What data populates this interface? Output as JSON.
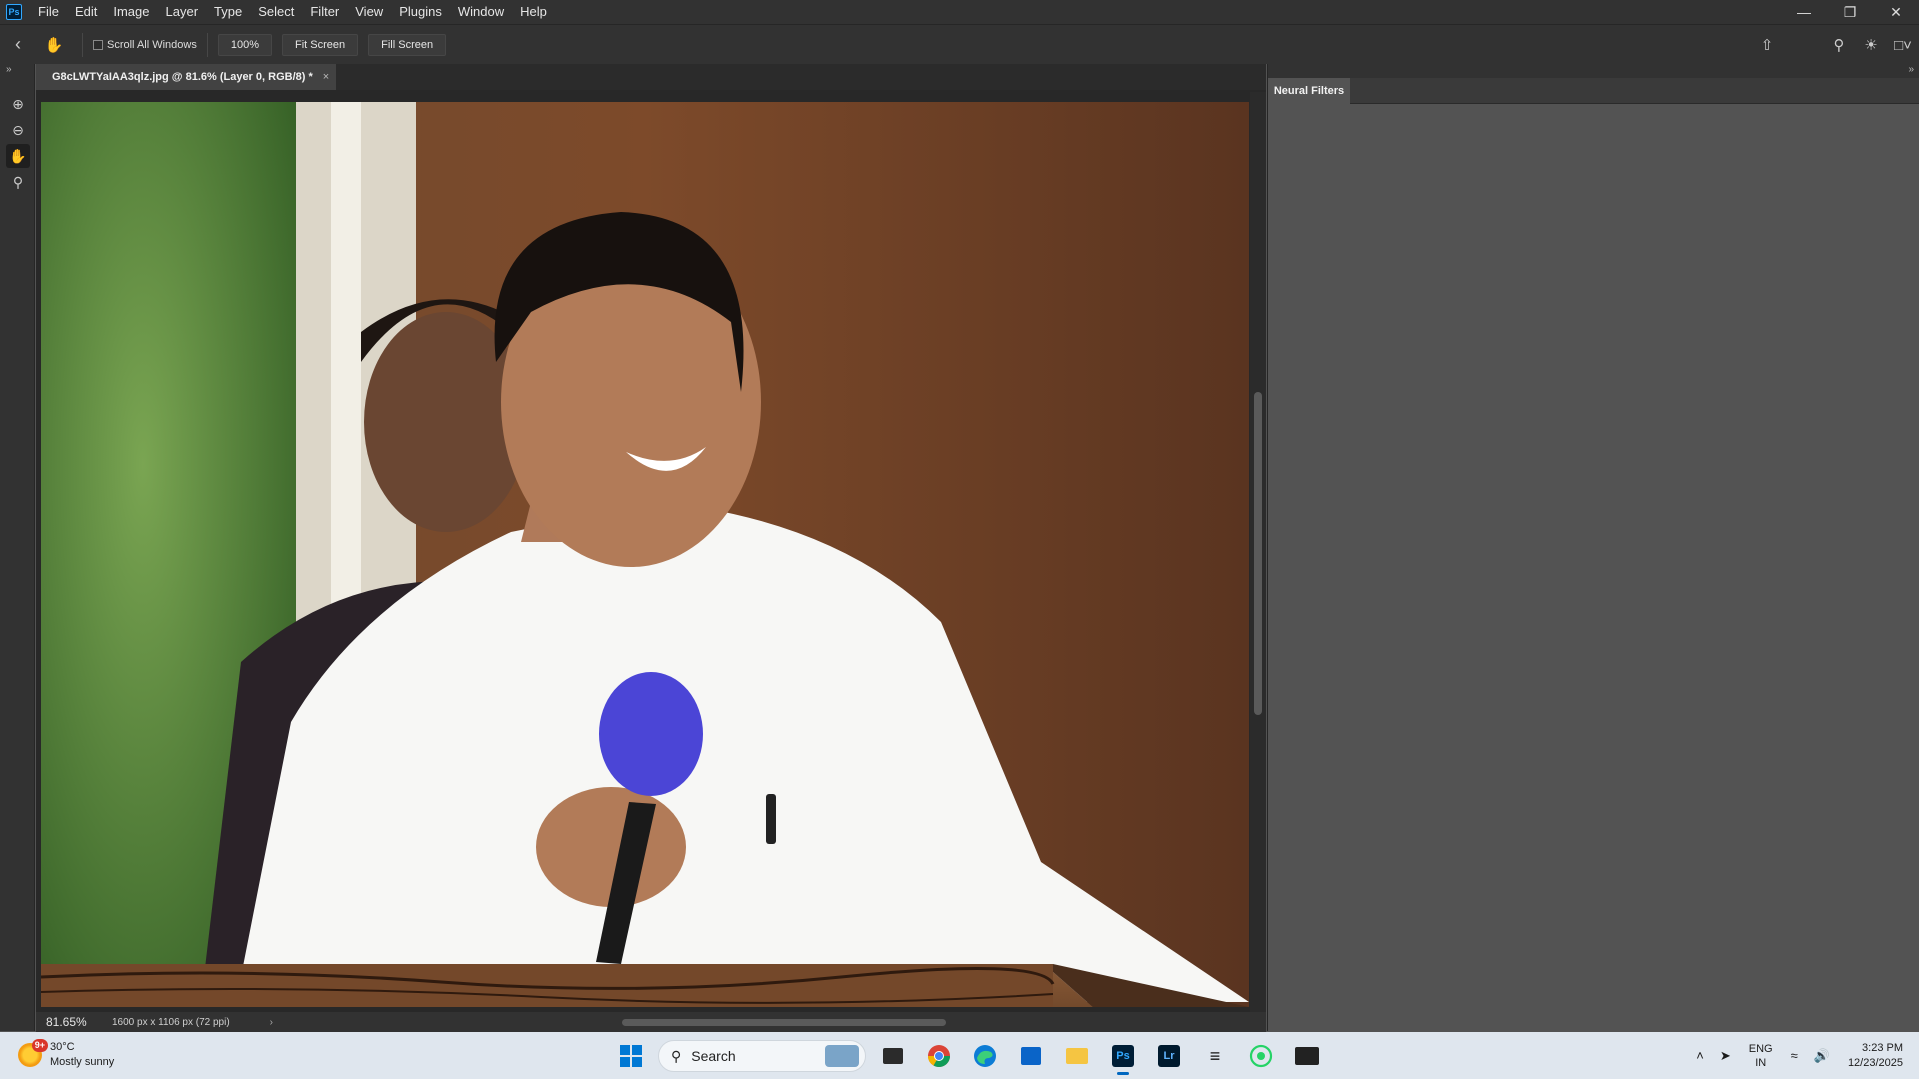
{
  "menubar": {
    "app_logo": "Ps",
    "items": [
      "File",
      "Edit",
      "Image",
      "Layer",
      "Type",
      "Select",
      "Filter",
      "View",
      "Plugins",
      "Window",
      "Help"
    ],
    "window_controls": [
      "minimize-icon",
      "restore-icon",
      "close-icon"
    ]
  },
  "optionsbar": {
    "scroll_all_label": "Scroll All Windows",
    "btn_100": "100%",
    "btn_fit": "Fit Screen",
    "btn_fill": "Fill Screen"
  },
  "document": {
    "tab_title": "G8cLWTYaIAA3qlz.jpg @ 81.6% (Layer 0, RGB/8) *",
    "close_glyph": "×"
  },
  "statusbar": {
    "zoom": "81.65%",
    "doc_info": "1600 px x 1106 px (72 ppi)"
  },
  "rightpanel": {
    "tab": "Neural Filters"
  },
  "taskbar": {
    "weather_badge": "9+",
    "temperature": "30°C",
    "condition": "Mostly sunny",
    "search_label": "Search",
    "apps": [
      "windows-start-icon",
      "file-explorer-icon",
      "chrome-icon",
      "edge-icon",
      "store-icon",
      "folder-icon",
      "photoshop-icon",
      "lightroom-icon",
      "capcut-icon",
      "whatsapp-icon",
      "esports-app-icon"
    ],
    "ps_label": "Ps",
    "lr_label": "Lr",
    "lang_line1": "ENG",
    "lang_line2": "IN",
    "time": "3:23 PM",
    "date": "12/23/2025"
  },
  "colors": {
    "ps_blue": "#31a8ff",
    "mic_purple": "#4b45d6"
  }
}
